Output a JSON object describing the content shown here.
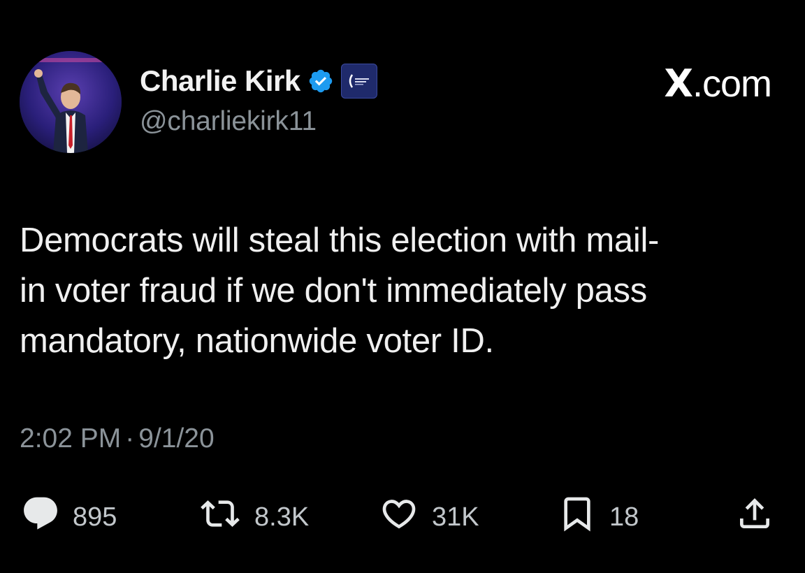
{
  "header": {
    "display_name": "Charlie Kirk",
    "handle": "@charliekirk11",
    "verified_icon": "verified-badge-icon",
    "affiliate_icon": "organization-badge-icon",
    "brand": ".com",
    "brand_prefix": "X"
  },
  "tweet": {
    "text_lines": [
      "Democrats will steal this election with mail-",
      "in voter fraud if we don't immediately pass",
      "mandatory, nationwide voter ID."
    ],
    "time": "2:02 PM",
    "separator": "·",
    "date": "9/1/20"
  },
  "actions": {
    "reply": {
      "icon": "reply-icon",
      "count": "895"
    },
    "repost": {
      "icon": "repost-icon",
      "count": "8.3K"
    },
    "like": {
      "icon": "heart-icon",
      "count": "31K"
    },
    "bookmark": {
      "icon": "bookmark-icon",
      "count": "18"
    },
    "share": {
      "icon": "share-icon"
    }
  },
  "colors": {
    "background": "#000000",
    "text": "#e7e9ea",
    "muted": "#8b9399",
    "verified": "#1d9bf0"
  }
}
